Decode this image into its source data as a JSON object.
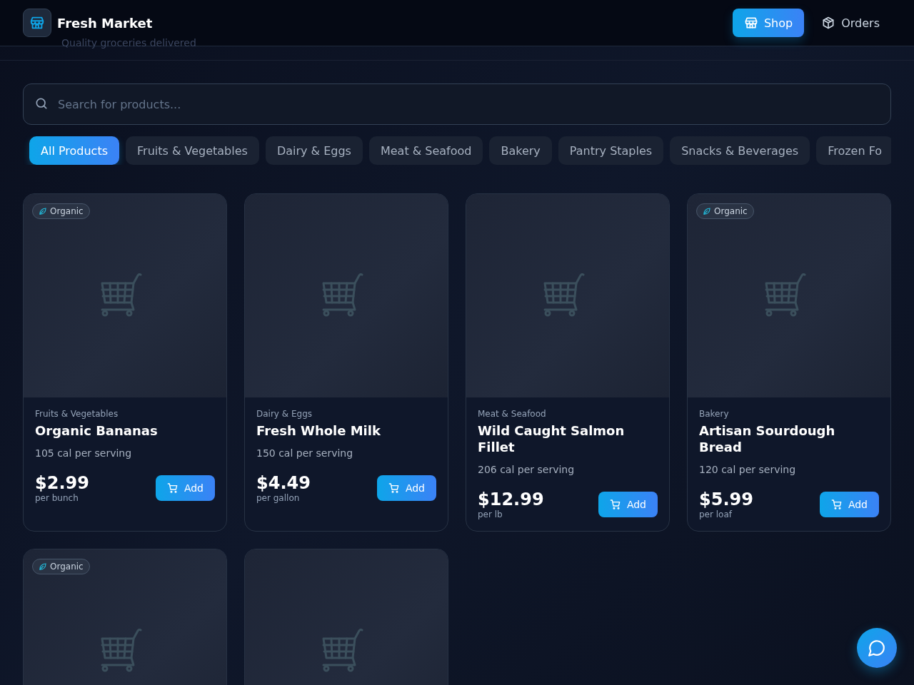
{
  "header": {
    "title": "Fresh Market",
    "subtitle": "Quality groceries delivered",
    "nav": [
      {
        "label": "Shop",
        "selected": true
      },
      {
        "label": "Orders",
        "selected": false
      }
    ]
  },
  "search": {
    "placeholder": "Search for products..."
  },
  "categories": [
    {
      "label": "All Products",
      "selected": true
    },
    {
      "label": "Fruits & Vegetables",
      "selected": false
    },
    {
      "label": "Dairy & Eggs",
      "selected": false
    },
    {
      "label": "Meat & Seafood",
      "selected": false
    },
    {
      "label": "Bakery",
      "selected": false
    },
    {
      "label": "Pantry Staples",
      "selected": false
    },
    {
      "label": "Snacks & Beverages",
      "selected": false
    },
    {
      "label": "Frozen Fo",
      "selected": false
    }
  ],
  "products": [
    {
      "organic": true,
      "badge": "Organic",
      "category": "Fruits & Vegetables",
      "name": "Organic Bananas",
      "calories": "105 cal per serving",
      "price": "$2.99",
      "unit": "per bunch",
      "button": "Add"
    },
    {
      "organic": false,
      "category": "Dairy & Eggs",
      "name": "Fresh Whole Milk",
      "calories": "150 cal per serving",
      "price": "$4.49",
      "unit": "per gallon",
      "button": "Add"
    },
    {
      "organic": false,
      "category": "Meat & Seafood",
      "name": "Wild Caught Salmon Fillet",
      "calories": "206 cal per serving",
      "price": "$12.99",
      "unit": "per lb",
      "button": "Add"
    },
    {
      "organic": true,
      "badge": "Organic",
      "category": "Bakery",
      "name": "Artisan Sourdough Bread",
      "calories": "120 cal per serving",
      "price": "$5.99",
      "unit": "per loaf",
      "button": "Add"
    },
    {
      "organic": true,
      "badge": "Organic"
    },
    {
      "organic": false
    }
  ]
}
